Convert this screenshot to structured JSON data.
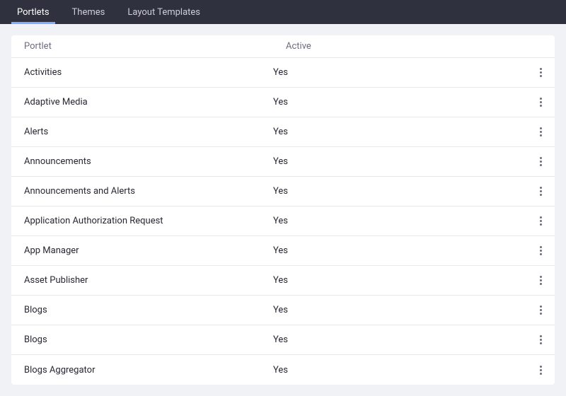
{
  "nav": {
    "tabs": [
      {
        "label": "Portlets",
        "active": true
      },
      {
        "label": "Themes",
        "active": false
      },
      {
        "label": "Layout Templates",
        "active": false
      }
    ]
  },
  "table": {
    "headers": {
      "name": "Portlet",
      "active": "Active"
    },
    "rows": [
      {
        "name": "Activities",
        "active": "Yes"
      },
      {
        "name": "Adaptive Media",
        "active": "Yes"
      },
      {
        "name": "Alerts",
        "active": "Yes"
      },
      {
        "name": "Announcements",
        "active": "Yes"
      },
      {
        "name": "Announcements and Alerts",
        "active": "Yes"
      },
      {
        "name": "Application Authorization Request",
        "active": "Yes"
      },
      {
        "name": "App Manager",
        "active": "Yes"
      },
      {
        "name": "Asset Publisher",
        "active": "Yes"
      },
      {
        "name": "Blogs",
        "active": "Yes"
      },
      {
        "name": "Blogs",
        "active": "Yes"
      },
      {
        "name": "Blogs Aggregator",
        "active": "Yes"
      }
    ]
  }
}
